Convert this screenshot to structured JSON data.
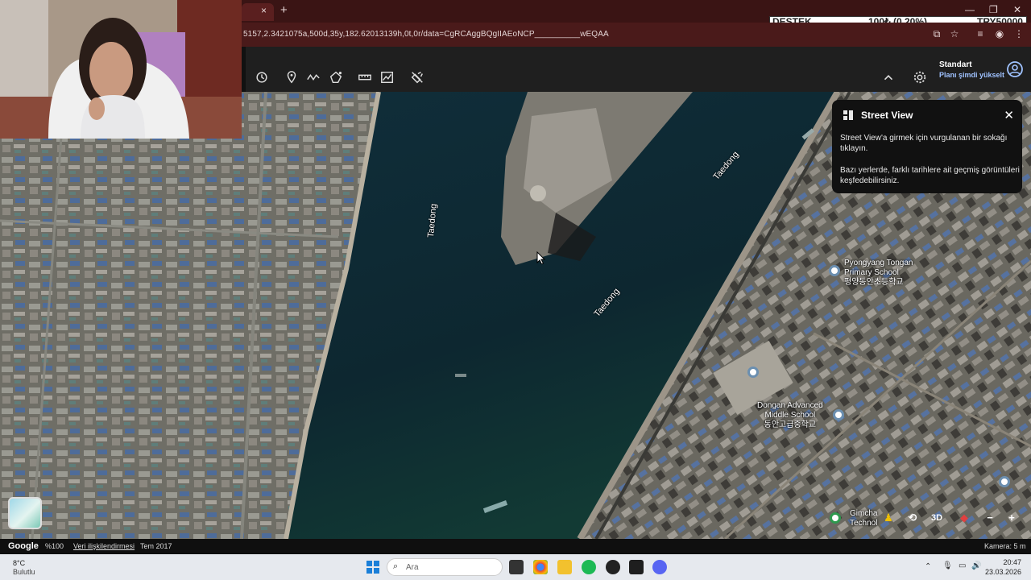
{
  "browser": {
    "url": "5157,2.3421075a,500d,35y,182.62013139h,0t,0r/data=CgRCAggBQgIIAEoNCP__________wEQAA",
    "new_tab_label": "+",
    "tab_close_label": "×",
    "window_controls": [
      "—",
      "❐",
      "✕"
    ]
  },
  "ticker": {
    "label": "DESTEK",
    "value": "100₺ (0.20%)",
    "goal": "TRY50000"
  },
  "toolbar": {
    "account_name": "Standart",
    "account_upgrade": "Planı şimdi yükselt",
    "icons": [
      "history-icon",
      "pin-icon",
      "path-icon",
      "polygon-icon",
      "ruler-icon",
      "chart-icon",
      "satellite-off-icon"
    ]
  },
  "map": {
    "river_labels": [
      "Taedong",
      "Taedong",
      "Taedong"
    ],
    "pois": [
      {
        "name": "Pyongyang Tongan\nPrimary School",
        "native": "평양동안초등학교"
      },
      {
        "name": "Dongan Advanced\nMiddle School",
        "native": "동안고급중학교"
      },
      {
        "name": "Gimcha\nTechnol"
      }
    ]
  },
  "street_view": {
    "title": "Street View",
    "line1": "Street View'a girmek için vurgulanan bir sokağı tıklayın.",
    "line2": "Bazı yerlerde, farklı tarihlere ait geçmiş görüntüleri keşfedebilirsiniz.",
    "close": "✕"
  },
  "controls": {
    "three_d": "3D",
    "zoom_out": "−",
    "zoom_in": "+"
  },
  "status": {
    "logo": "Google",
    "zoom": "%100",
    "data_link": "Veri ilişkilendirmesi",
    "date": "Tem 2017",
    "camera": "Kamera: 5 m"
  },
  "taskbar": {
    "weather_temp": "8°C",
    "weather_desc": "Bulutlu",
    "search_placeholder": "Ara",
    "time": "20:47",
    "date": "23.03.2026"
  },
  "colors": {
    "river": "#0f2a35",
    "urban": "#6f6e66",
    "tabbar": "#3a1414",
    "urlbar": "#4a1a1a",
    "toolbar": "#1f1f1f"
  }
}
